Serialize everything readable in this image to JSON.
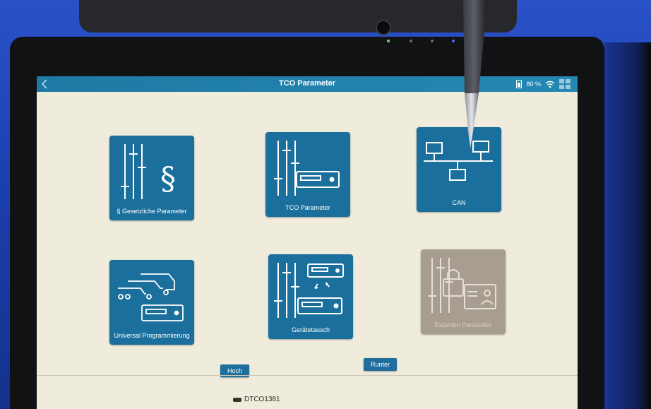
{
  "titlebar": {
    "title": "TCO Parameter",
    "battery": "80 %"
  },
  "tiles": [
    {
      "label": "§ Gesetzliche Parameter",
      "icon": "law-parameter-icon",
      "enabled": true
    },
    {
      "label": "TCO Parameter",
      "icon": "tachograph-parameter-icon",
      "enabled": true
    },
    {
      "label": "CAN",
      "icon": "network-icon",
      "enabled": true
    },
    {
      "label": "Universal Programmierung",
      "icon": "vehicle-fleet-icon",
      "enabled": true
    },
    {
      "label": "Gerätetausch",
      "icon": "device-exchange-icon",
      "enabled": true
    },
    {
      "label": "Experten Parameter",
      "icon": "locked-expert-icon",
      "enabled": false
    }
  ],
  "buttons": {
    "up": "Hoch",
    "down": "Runter"
  },
  "footer": {
    "device": "DTCO1381"
  },
  "colors": {
    "titlebar": "#2587b3",
    "tile": "#1a6f9c",
    "tile_disabled": "#a79d90",
    "screen_bg": "#f0ecdc"
  }
}
